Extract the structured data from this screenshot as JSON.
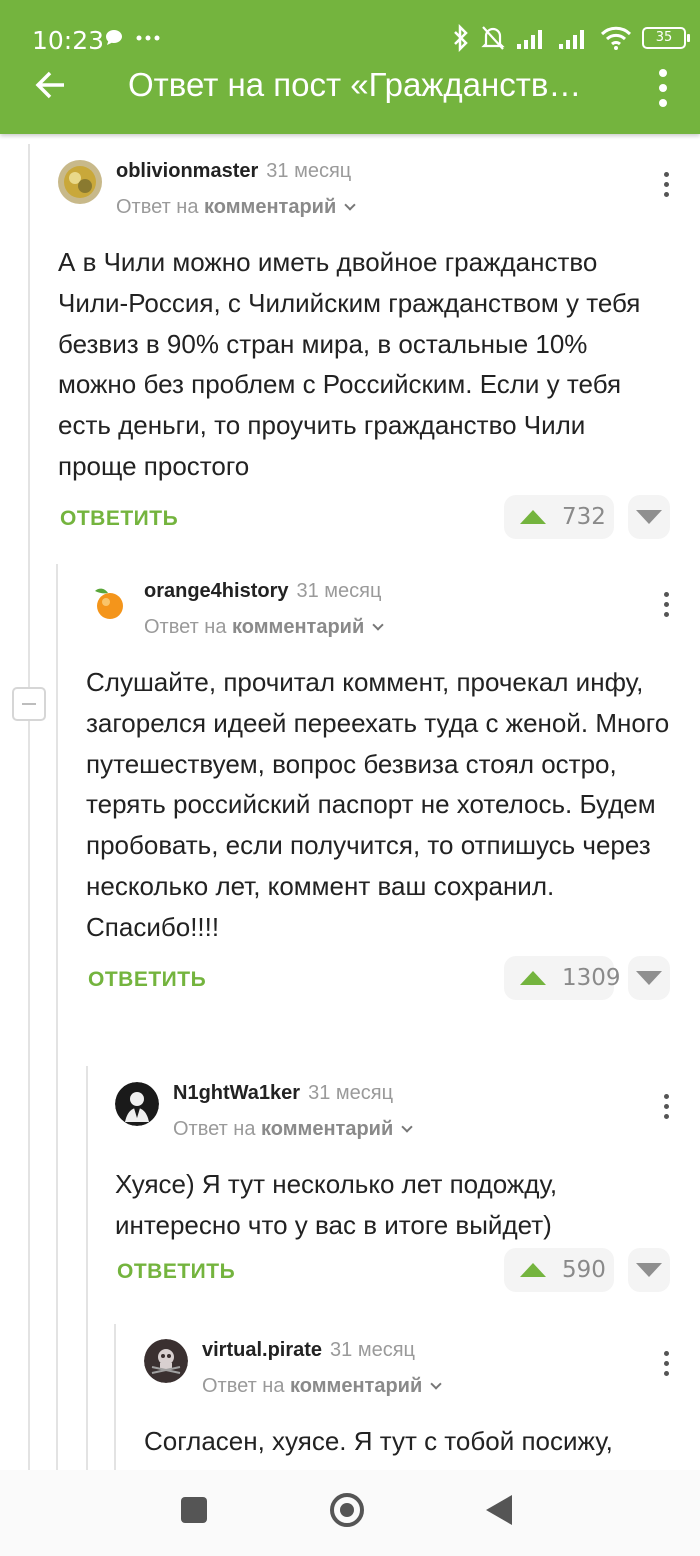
{
  "status_bar": {
    "time": "10:23",
    "battery": "35"
  },
  "header": {
    "title": "Ответ на пост «Гражданств…"
  },
  "comments": [
    {
      "author": "oblivionmaster",
      "date": "31 месяц",
      "reply_prefix": "Ответ на",
      "reply_target": "комментарий",
      "text": "А в Чили можно иметь двойное гражданство Чили-Россия, с Чилийским гражданством у тебя безвиз в 90% стран мира, в остальные 10% можно без проблем с Российским. Если у тебя есть деньги, то проучить гражданство Чили проще простого",
      "reply_label": "ОТВЕТИТЬ",
      "rating": "732"
    },
    {
      "author": "orange4history",
      "date": "31 месяц",
      "reply_prefix": "Ответ на",
      "reply_target": "комментарий",
      "text": "Слушайте, прочитал коммент, прочекал инфу, загорелся идеей переехать туда с женой. Много путешествуем, вопрос безвиза стоял остро, терять российский паспорт не хотелось. Будем пробовать, если получится, то отпишусь через несколько лет, коммент ваш сохранил. Спасибо!!!!",
      "reply_label": "ОТВЕТИТЬ",
      "rating": "1309"
    },
    {
      "author": "N1ghtWa1ker",
      "date": "31 месяц",
      "reply_prefix": "Ответ на",
      "reply_target": "комментарий",
      "text": "Хуясе) Я тут несколько лет подожду, интересно что у вас в итоге выйдет)",
      "reply_label": "ОТВЕТИТЬ",
      "rating": "590"
    },
    {
      "author": "virtual.pirate",
      "date": "31 месяц",
      "reply_prefix": "Ответ на",
      "reply_target": "комментарий",
      "text": "Согласен, хуясе. Я тут с тобой посижу,"
    }
  ],
  "colors": {
    "accent": "#74b43e",
    "muted": "#9a9a9a"
  }
}
